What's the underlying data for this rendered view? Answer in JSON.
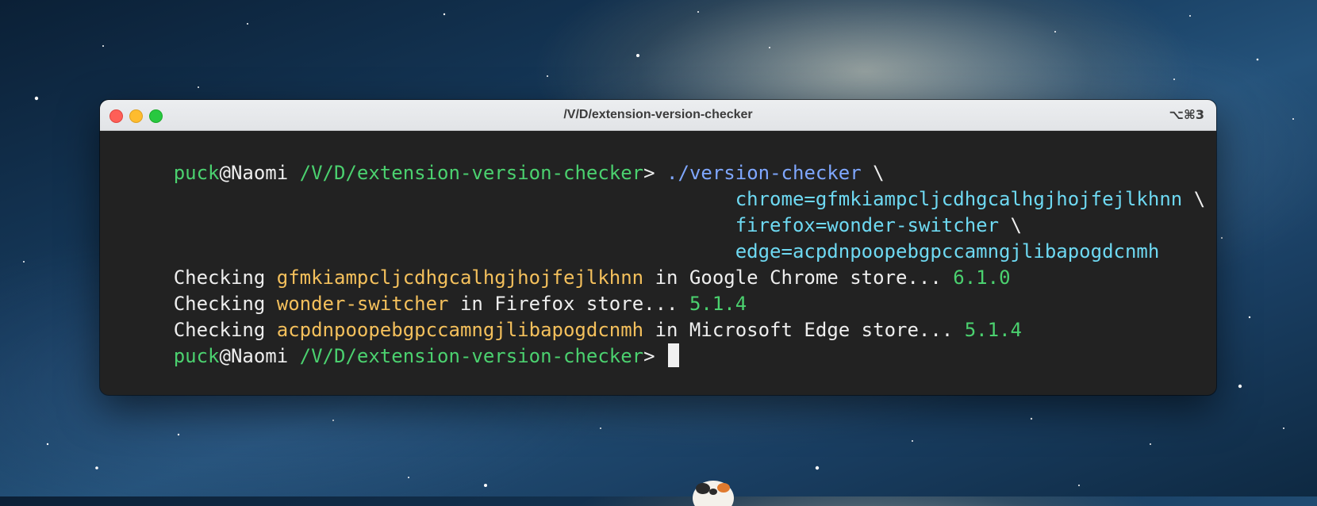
{
  "window": {
    "title": "/V/D/extension-version-checker",
    "shortcut": "⌥⌘3"
  },
  "terminal": {
    "prompt_user": "puck",
    "prompt_at": "@",
    "prompt_host": "Naomi",
    "prompt_path": "/V/D/extension-version-checker",
    "prompt_symbol": ">",
    "command": "./version-checker",
    "continuation": "\\",
    "args": [
      "chrome=gfmkiampcljcdhgcalhgjhojfejlkhnn",
      "firefox=wonder-switcher",
      "edge=acpdnpoopebgpccamngjlibapogdcnmh"
    ],
    "checks": [
      {
        "prefix": "Checking",
        "id": "gfmkiampcljcdhgcalhgjhojfejlkhnn",
        "store": "in Google Chrome store...",
        "version": "6.1.0"
      },
      {
        "prefix": "Checking",
        "id": "wonder-switcher",
        "store": "in Firefox store...",
        "version": "5.1.4"
      },
      {
        "prefix": "Checking",
        "id": "acpdnpoopebgpccamngjlibapogdcnmh",
        "store": "in Microsoft Edge store...",
        "version": "5.1.4"
      }
    ]
  },
  "colors": {
    "prompt_green": "#4bd16f",
    "command_blue": "#7fa7ff",
    "args_cyan": "#6ed9f2",
    "id_yellow": "#f4c05c",
    "terminal_bg": "#222222"
  },
  "icons": {
    "traffic_lights": [
      "close-button",
      "minimize-button",
      "zoom-button"
    ],
    "dock": "dock-app-icon"
  }
}
